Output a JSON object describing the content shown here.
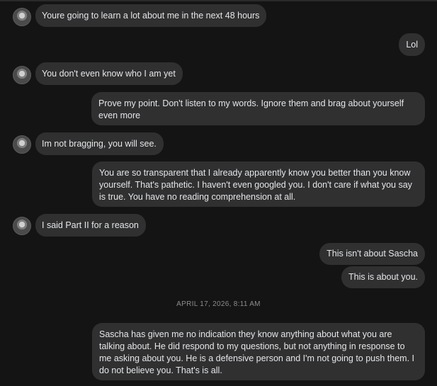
{
  "conversation": {
    "messages": [
      {
        "id": 1,
        "direction": "incoming",
        "text": "Youre going to learn a lot about me in the next 48 hours"
      },
      {
        "id": 2,
        "direction": "outgoing",
        "text": "Lol"
      },
      {
        "id": 3,
        "direction": "incoming",
        "text": "You don't even know who I am yet"
      },
      {
        "id": 4,
        "direction": "outgoing",
        "text": "Prove my point. Don't listen to my words. Ignore them and brag about yourself even more"
      },
      {
        "id": 5,
        "direction": "incoming",
        "text": "Im not bragging, you will see."
      },
      {
        "id": 6,
        "direction": "outgoing",
        "text": "You are so transparent that I already apparently know you better than you know yourself. That's pathetic. I haven't even googled you. I don't care if what you say is true. You have no reading comprehension at all."
      },
      {
        "id": 7,
        "direction": "incoming",
        "text": "I said Part II for a reason"
      },
      {
        "id": 8,
        "direction": "outgoing",
        "text": "This isn't about Sascha"
      },
      {
        "id": 9,
        "direction": "outgoing",
        "text": "This is about you."
      },
      {
        "id": 10,
        "direction": "outgoing",
        "text": "Sascha has given me no indication they know anything about what you are talking about. He did respond to my questions, but not anything in response to me asking about you. He is a defensive person and I'm not going to push them. I do not believe you. That's is all."
      }
    ],
    "timestamp": "APRIL 17, 2026, 8:11 AM"
  },
  "colors": {
    "background": "#141414",
    "bubble": "#303030",
    "text": "#e4e6eb",
    "timestamp": "#8c8c8c"
  },
  "icons": {
    "contact_avatar": "contact-avatar-icon"
  }
}
